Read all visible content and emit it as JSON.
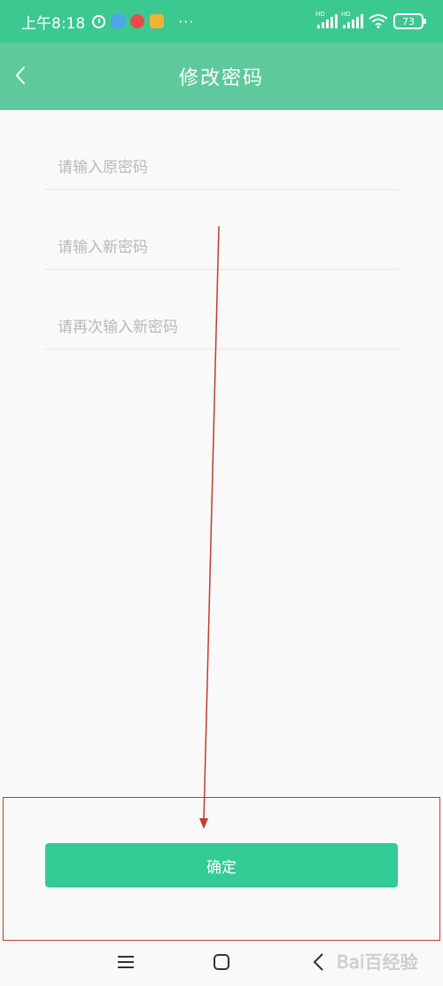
{
  "status_bar": {
    "time": "上午8:18",
    "more": "···",
    "battery": "73",
    "network_label": "HD",
    "icons": [
      "alarm-icon",
      "app-icon",
      "app-icon",
      "app-icon",
      "signal-icon",
      "signal-icon",
      "wifi-icon",
      "battery-icon"
    ]
  },
  "header": {
    "title": "修改密码",
    "back_icon": "chevron-left-icon"
  },
  "form": {
    "old_password_placeholder": "请输入原密码",
    "new_password_placeholder": "请输入新密码",
    "confirm_password_placeholder": "请再次输入新密码"
  },
  "confirm_button": {
    "label": "确定"
  },
  "nav_bar": {
    "icons": [
      "menu-icon",
      "home-icon",
      "back-icon"
    ]
  },
  "watermark": {
    "text": "Bai百经验"
  },
  "colors": {
    "status_bar": "#3cc891",
    "header": "#5ec99d",
    "button": "#33cc94",
    "annotation": "#c23b32",
    "background": "#f9f9f9"
  }
}
